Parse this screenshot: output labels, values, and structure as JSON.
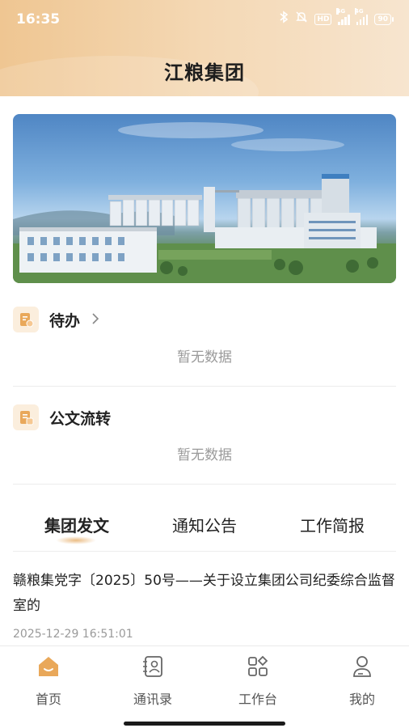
{
  "status_bar": {
    "time": "16:35",
    "hd": "HD",
    "network_1": "4G",
    "network_2": "4G",
    "battery": "90"
  },
  "header": {
    "title": "江粮集团"
  },
  "banner": {
    "image": "grain-silo-facility-photo"
  },
  "todo": {
    "title": "待办",
    "empty_text": "暂无数据",
    "icon": "todo-document-icon"
  },
  "document_flow": {
    "title": "公文流转",
    "empty_text": "暂无数据",
    "icon": "document-flow-icon"
  },
  "news_tabs": [
    {
      "label": "集团发文",
      "active": true
    },
    {
      "label": "通知公告",
      "active": false
    },
    {
      "label": "工作简报",
      "active": false
    }
  ],
  "article": {
    "title": "赣粮集党字〔2025〕50号——关于设立集团公司纪委综合监督室的",
    "time": "2025-12-29 16:51:01"
  },
  "tabbar": [
    {
      "label": "首页",
      "icon": "home-icon",
      "active": true
    },
    {
      "label": "通讯录",
      "icon": "contacts-icon",
      "active": false
    },
    {
      "label": "工作台",
      "icon": "workbench-icon",
      "active": false
    },
    {
      "label": "我的",
      "icon": "profile-icon",
      "active": false
    }
  ],
  "colors": {
    "accent": "#e6a85d",
    "header_start": "#efc692",
    "header_end": "#f7e5cf"
  }
}
